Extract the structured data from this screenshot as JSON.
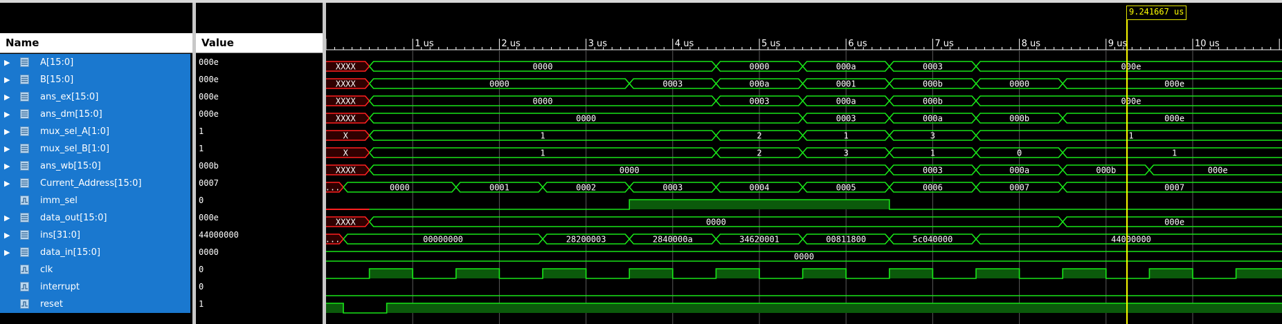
{
  "headers": {
    "name": "Name",
    "value": "Value"
  },
  "cursor": {
    "time_label": "9.241667 us",
    "time_us": 9.241667
  },
  "time_axis": {
    "ticks": [
      "1 us",
      "2 us",
      "3 us",
      "4 us",
      "5 us",
      "6 us",
      "7 us",
      "8 us",
      "9 us",
      "10 us"
    ]
  },
  "colors": {
    "wave": "#19e619",
    "undefined": "#ff2020",
    "cursor": "#ffff00",
    "selected_row": "#1a78cf"
  },
  "signals": [
    {
      "name": "A[15:0]",
      "value": "000e",
      "type": "bus",
      "icon": "bus-signal-icon",
      "segments": [
        {
          "t": 0,
          "v": "XXXX"
        },
        {
          "t": 0.5,
          "v": "0000"
        },
        {
          "t": 4.5,
          "v": "0000"
        },
        {
          "t": 5.5,
          "v": "000a"
        },
        {
          "t": 6.5,
          "v": "0003"
        },
        {
          "t": 7.5,
          "v": "000e"
        }
      ]
    },
    {
      "name": "B[15:0]",
      "value": "000e",
      "type": "bus",
      "icon": "bus-signal-icon",
      "segments": [
        {
          "t": 0,
          "v": "XXXX"
        },
        {
          "t": 0.5,
          "v": "0000"
        },
        {
          "t": 3.5,
          "v": "0003"
        },
        {
          "t": 4.5,
          "v": "000a"
        },
        {
          "t": 5.5,
          "v": "0001"
        },
        {
          "t": 6.5,
          "v": "000b"
        },
        {
          "t": 7.5,
          "v": "0000"
        },
        {
          "t": 8.5,
          "v": "000e"
        }
      ]
    },
    {
      "name": "ans_ex[15:0]",
      "value": "000e",
      "type": "bus",
      "icon": "bus-signal-icon",
      "segments": [
        {
          "t": 0,
          "v": "XXXX"
        },
        {
          "t": 0.5,
          "v": "0000"
        },
        {
          "t": 4.5,
          "v": "0003"
        },
        {
          "t": 5.5,
          "v": "000a"
        },
        {
          "t": 6.5,
          "v": "000b"
        },
        {
          "t": 7.5,
          "v": "000e"
        }
      ]
    },
    {
      "name": "ans_dm[15:0]",
      "value": "000e",
      "type": "bus",
      "icon": "bus-signal-icon",
      "segments": [
        {
          "t": 0,
          "v": "XXXX"
        },
        {
          "t": 0.5,
          "v": "0000"
        },
        {
          "t": 5.5,
          "v": "0003"
        },
        {
          "t": 6.5,
          "v": "000a"
        },
        {
          "t": 7.5,
          "v": "000b"
        },
        {
          "t": 8.5,
          "v": "000e"
        }
      ]
    },
    {
      "name": "mux_sel_A[1:0]",
      "value": "1",
      "type": "bus",
      "icon": "bus-signal-icon",
      "segments": [
        {
          "t": 0,
          "v": "X"
        },
        {
          "t": 0.5,
          "v": "1"
        },
        {
          "t": 4.5,
          "v": "2"
        },
        {
          "t": 5.5,
          "v": "1"
        },
        {
          "t": 6.5,
          "v": "3"
        },
        {
          "t": 7.5,
          "v": "1"
        }
      ]
    },
    {
      "name": "mux_sel_B[1:0]",
      "value": "1",
      "type": "bus",
      "icon": "bus-signal-icon",
      "segments": [
        {
          "t": 0,
          "v": "X"
        },
        {
          "t": 0.5,
          "v": "1"
        },
        {
          "t": 4.5,
          "v": "2"
        },
        {
          "t": 5.5,
          "v": "3"
        },
        {
          "t": 6.5,
          "v": "1"
        },
        {
          "t": 7.5,
          "v": "0"
        },
        {
          "t": 8.5,
          "v": "1"
        }
      ]
    },
    {
      "name": "ans_wb[15:0]",
      "value": "000b",
      "type": "bus",
      "icon": "bus-signal-icon",
      "segments": [
        {
          "t": 0,
          "v": "XXXX"
        },
        {
          "t": 0.5,
          "v": "0000"
        },
        {
          "t": 6.5,
          "v": "0003"
        },
        {
          "t": 7.5,
          "v": "000a"
        },
        {
          "t": 8.5,
          "v": "000b"
        },
        {
          "t": 9.5,
          "v": "000e"
        }
      ]
    },
    {
      "name": "Current_Address[15:0]",
      "value": "0007",
      "type": "bus",
      "icon": "bus-signal-icon",
      "segments": [
        {
          "t": 0,
          "v": "..."
        },
        {
          "t": 0.2,
          "v": "0000"
        },
        {
          "t": 1.5,
          "v": "0001"
        },
        {
          "t": 2.5,
          "v": "0002"
        },
        {
          "t": 3.5,
          "v": "0003"
        },
        {
          "t": 4.5,
          "v": "0004"
        },
        {
          "t": 5.5,
          "v": "0005"
        },
        {
          "t": 6.5,
          "v": "0006"
        },
        {
          "t": 7.5,
          "v": "0007"
        },
        {
          "t": 8.5,
          "v": "0007"
        }
      ]
    },
    {
      "name": "imm_sel",
      "value": "0",
      "type": "bit",
      "icon": "bit-signal-icon",
      "edges": [
        {
          "t": 0,
          "v": "x"
        },
        {
          "t": 0.5,
          "v": 0
        },
        {
          "t": 3.5,
          "v": 1
        },
        {
          "t": 6.5,
          "v": 0
        }
      ]
    },
    {
      "name": "data_out[15:0]",
      "value": "000e",
      "type": "bus",
      "icon": "bus-signal-icon",
      "segments": [
        {
          "t": 0,
          "v": "XXXX"
        },
        {
          "t": 0.5,
          "v": "0000"
        },
        {
          "t": 8.5,
          "v": "000e"
        }
      ]
    },
    {
      "name": "ins[31:0]",
      "value": "44000000",
      "type": "bus",
      "icon": "bus-signal-icon",
      "segments": [
        {
          "t": 0,
          "v": "..."
        },
        {
          "t": 0.2,
          "v": "00000000"
        },
        {
          "t": 2.5,
          "v": "28200003"
        },
        {
          "t": 3.5,
          "v": "2840000a"
        },
        {
          "t": 4.5,
          "v": "34620001"
        },
        {
          "t": 5.5,
          "v": "00811800"
        },
        {
          "t": 6.5,
          "v": "5c040000"
        },
        {
          "t": 7.5,
          "v": "44000000"
        }
      ]
    },
    {
      "name": "data_in[15:0]",
      "value": "0000",
      "type": "bus",
      "icon": "bus-signal-icon",
      "segments": [
        {
          "t": 0,
          "v": "0000"
        }
      ]
    },
    {
      "name": "clk",
      "value": "0",
      "type": "bit",
      "icon": "bit-signal-icon",
      "edges": [
        {
          "t": 0,
          "v": 0
        },
        {
          "t": 0.5,
          "v": 1
        },
        {
          "t": 1,
          "v": 0
        },
        {
          "t": 1.5,
          "v": 1
        },
        {
          "t": 2,
          "v": 0
        },
        {
          "t": 2.5,
          "v": 1
        },
        {
          "t": 3,
          "v": 0
        },
        {
          "t": 3.5,
          "v": 1
        },
        {
          "t": 4,
          "v": 0
        },
        {
          "t": 4.5,
          "v": 1
        },
        {
          "t": 5,
          "v": 0
        },
        {
          "t": 5.5,
          "v": 1
        },
        {
          "t": 6,
          "v": 0
        },
        {
          "t": 6.5,
          "v": 1
        },
        {
          "t": 7,
          "v": 0
        },
        {
          "t": 7.5,
          "v": 1
        },
        {
          "t": 8,
          "v": 0
        },
        {
          "t": 8.5,
          "v": 1
        },
        {
          "t": 9,
          "v": 0
        },
        {
          "t": 9.5,
          "v": 1
        },
        {
          "t": 10,
          "v": 0
        },
        {
          "t": 10.5,
          "v": 1
        }
      ]
    },
    {
      "name": "interrupt",
      "value": "0",
      "type": "bit",
      "icon": "bit-signal-icon",
      "edges": [
        {
          "t": 0,
          "v": 0
        }
      ]
    },
    {
      "name": "reset",
      "value": "1",
      "type": "bit",
      "icon": "bit-signal-icon",
      "edges": [
        {
          "t": 0,
          "v": 1
        },
        {
          "t": 0.2,
          "v": 0
        },
        {
          "t": 0.7,
          "v": 1
        }
      ]
    }
  ]
}
